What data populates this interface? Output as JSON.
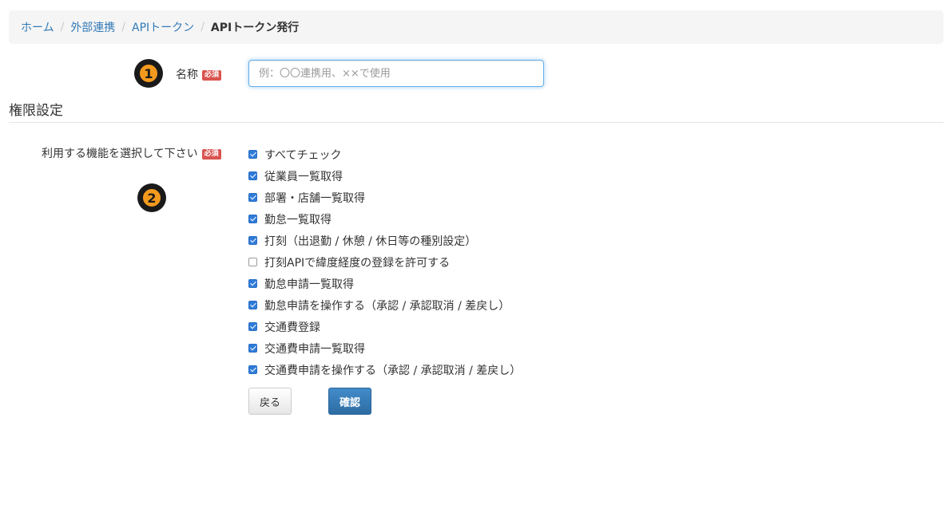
{
  "breadcrumb": {
    "items": [
      "ホーム",
      "外部連携",
      "APIトークン"
    ],
    "separator": "/",
    "current": "APIトークン発行"
  },
  "markers": [
    "1",
    "2"
  ],
  "name_field": {
    "label": "名称",
    "required_badge": "必須",
    "placeholder": "例：〇〇連携用、××で使用",
    "value": ""
  },
  "permissions": {
    "section_title": "権限設定",
    "label": "利用する機能を選択して下さい",
    "required_badge": "必須",
    "options": [
      {
        "label": "すべてチェック",
        "checked": true
      },
      {
        "label": "従業員一覧取得",
        "checked": true
      },
      {
        "label": "部署・店舗一覧取得",
        "checked": true
      },
      {
        "label": "勤怠一覧取得",
        "checked": true
      },
      {
        "label": "打刻（出退勤 / 休憩 / 休日等の種別設定）",
        "checked": true
      },
      {
        "label": "打刻APIで緯度経度の登録を許可する",
        "checked": false
      },
      {
        "label": "勤怠申請一覧取得",
        "checked": true
      },
      {
        "label": "勤怠申請を操作する（承認 / 承認取消 / 差戻し）",
        "checked": true
      },
      {
        "label": "交通費登録",
        "checked": true
      },
      {
        "label": "交通費申請一覧取得",
        "checked": true
      },
      {
        "label": "交通費申請を操作する（承認 / 承認取消 / 差戻し）",
        "checked": true
      }
    ]
  },
  "buttons": {
    "back": "戻る",
    "confirm": "確認"
  },
  "colors": {
    "link": "#337ab7",
    "required": "#d9534f",
    "primary": "#337ab7",
    "marker": "#f39a1e"
  }
}
